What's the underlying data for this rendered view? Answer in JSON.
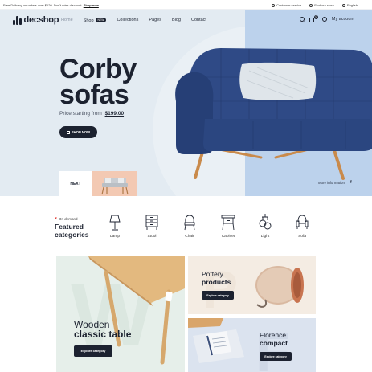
{
  "topbar": {
    "promo": "Free Delivery on orders over $120. Don't miss discount.",
    "promo_link": "Shop now",
    "links": [
      "Customer service",
      "Find our store",
      "English"
    ]
  },
  "nav": {
    "logo": "decshop",
    "menu": [
      {
        "label": "Home"
      },
      {
        "label": "Shop",
        "badge": "NEW"
      },
      {
        "label": "Collections"
      },
      {
        "label": "Pages"
      },
      {
        "label": "Blog"
      },
      {
        "label": "Contact"
      }
    ],
    "cart_count": "0",
    "account_label": "My account"
  },
  "hero": {
    "title_line1": "Corby",
    "title_line2": "sofas",
    "price_prefix": "Price starting from",
    "price": "$199.00",
    "cta": "SHOP NOW",
    "next_label": "NEXT",
    "more_info": "More information",
    "social_icon": "f"
  },
  "categories": {
    "eyebrow": "On demand",
    "title_line1": "Featured",
    "title_line2": "categories",
    "items": [
      {
        "label": "Lamp",
        "icon": "lamp-icon"
      },
      {
        "label": "Stool",
        "icon": "stool-icon"
      },
      {
        "label": "Chair",
        "icon": "chair-icon"
      },
      {
        "label": "Cabinet",
        "icon": "cabinet-icon"
      },
      {
        "label": "Light",
        "icon": "light-icon"
      },
      {
        "label": "Sofa",
        "icon": "sofa-icon"
      }
    ]
  },
  "promos": {
    "wood": {
      "line1": "Wooden",
      "line2": "classic table",
      "cta": "Explore category"
    },
    "pottery": {
      "line1": "Pottery",
      "line2": "products",
      "cta": "Explore category"
    },
    "florence": {
      "line1": "Florence",
      "line2": "compact",
      "cta": "Explore category"
    }
  },
  "colors": {
    "dark": "#1c2230",
    "hero_bg": "#e3ebf2",
    "hero_right": "#bcd2ec",
    "accent_heart": "#e2413b"
  }
}
